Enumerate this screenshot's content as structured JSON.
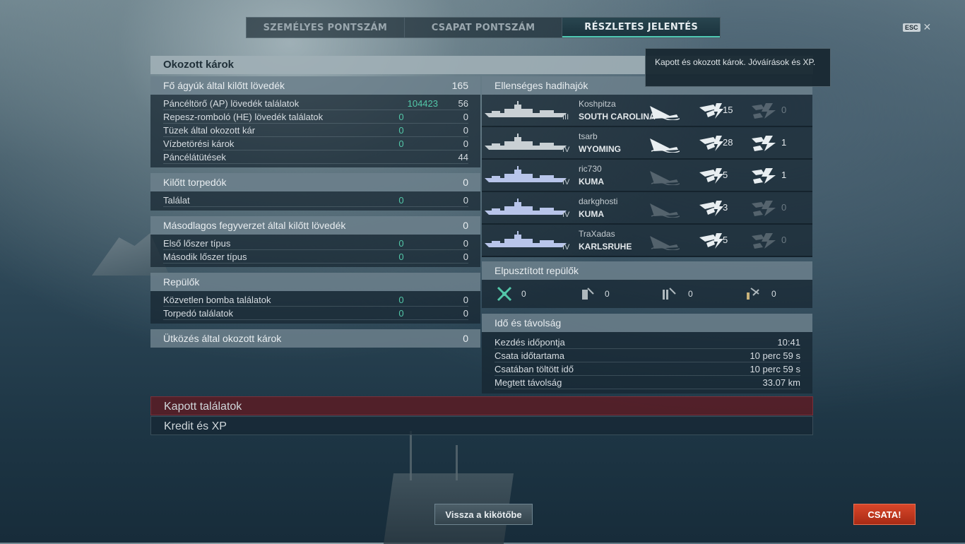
{
  "tabs": [
    {
      "label": "SZEMÉLYES PONTSZÁM",
      "active": false
    },
    {
      "label": "CSAPAT PONTSZÁM",
      "active": false
    },
    {
      "label": "RÉSZLETES JELENTÉS",
      "active": true
    }
  ],
  "esc": {
    "key": "ESC",
    "close": "✕"
  },
  "main_title": "Okozott károk",
  "tooltip": "Kapott és okozott károk. Jóváírások és XP.",
  "left": {
    "main_guns": {
      "title": "Fő ágyúk által kilőtt lövedék",
      "total": "165",
      "rows": [
        {
          "label": "Páncéltörő (AP) lövedék találatok",
          "v1": "104423",
          "v2": "56"
        },
        {
          "label": "Repesz-romboló (HE) lövedék találatok",
          "v1": "0",
          "v2": "0"
        },
        {
          "label": "Tüzek által okozott kár",
          "v1": "0",
          "v2": "0"
        },
        {
          "label": "Vízbetörési károk",
          "v1": "0",
          "v2": "0"
        },
        {
          "label": "Páncélátütések",
          "v1": "",
          "v2": "44"
        }
      ]
    },
    "torpedoes": {
      "title": "Kilőtt torpedók",
      "total": "0",
      "rows": [
        {
          "label": "Találat",
          "v1": "0",
          "v2": "0"
        }
      ]
    },
    "secondary": {
      "title": "Másodlagos fegyverzet által kilőtt lövedék",
      "total": "0",
      "rows": [
        {
          "label": "Első lőszer típus",
          "v1": "0",
          "v2": "0"
        },
        {
          "label": "Második lőszer típus",
          "v1": "0",
          "v2": "0"
        }
      ]
    },
    "planes": {
      "title": "Repülők",
      "total": "",
      "rows": [
        {
          "label": "Közvetlen bomba találatok",
          "v1": "0",
          "v2": "0"
        },
        {
          "label": "Torpedó találatok",
          "v1": "0",
          "v2": "0"
        }
      ]
    },
    "ramming": {
      "title": "Ütközés által okozott károk",
      "total": "0"
    }
  },
  "enemies": {
    "title": "Ellenséges hadihajók",
    "ships": [
      {
        "player": "Koshpitza",
        "ship": "SOUTH CAROLINA",
        "tier": "III",
        "sunk": true,
        "hits": "15",
        "fires": "0",
        "fires_active": false
      },
      {
        "player": "tsarb",
        "ship": "WYOMING",
        "tier": "IV",
        "sunk": true,
        "hits": "28",
        "fires": "1",
        "fires_active": true
      },
      {
        "player": "ric730",
        "ship": "KUMA",
        "tier": "IV",
        "sunk": false,
        "hits": "5",
        "fires": "1",
        "fires_active": true
      },
      {
        "player": "darkghosti",
        "ship": "KUMA",
        "tier": "IV",
        "sunk": false,
        "hits": "3",
        "fires": "0",
        "fires_active": false
      },
      {
        "player": "TraXadas",
        "ship": "KARLSRUHE",
        "tier": "IV",
        "sunk": false,
        "hits": "5",
        "fires": "0",
        "fires_active": false
      }
    ]
  },
  "destroyed_planes": {
    "title": "Elpusztított repülők",
    "items": [
      {
        "icon": "crossed-planes-icon",
        "count": "0"
      },
      {
        "icon": "fighter-icon",
        "count": "0"
      },
      {
        "icon": "torpedo-bomber-icon",
        "count": "0"
      },
      {
        "icon": "dive-bomber-icon",
        "count": "0"
      }
    ]
  },
  "time": {
    "title": "Idő és távolság",
    "rows": [
      {
        "label": "Kezdés időpontja",
        "value": "10:41"
      },
      {
        "label": "Csata időtartama",
        "value": "10 perc 59 s"
      },
      {
        "label": "Csatában töltött idő",
        "value": "10 perc 59 s"
      },
      {
        "label": "Megtett távolság",
        "value": "33.07 km"
      }
    ]
  },
  "bars": {
    "received": "Kapott találatok",
    "credits": "Kredit és XP"
  },
  "buttons": {
    "port": "Vissza a kikötőbe",
    "battle": "CSATA!"
  },
  "colors": {
    "accent_green": "#53c7a8",
    "battle_red": "#c23a1f"
  }
}
